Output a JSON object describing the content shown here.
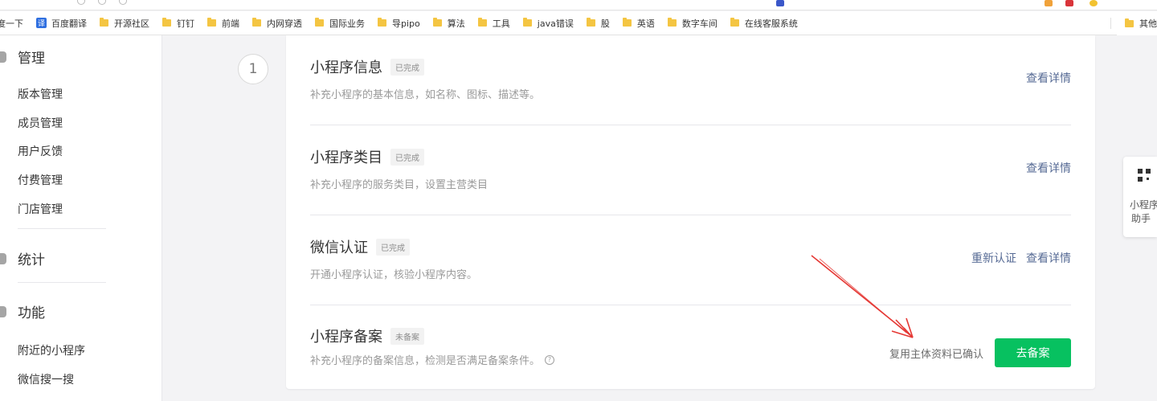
{
  "bookmarks": {
    "items": [
      {
        "label": "度一下",
        "icon": "none"
      },
      {
        "label": "百度翻译",
        "icon": "translate-icon",
        "glyph": "译"
      },
      {
        "label": "开源社区",
        "icon": "folder-icon"
      },
      {
        "label": "钉钉",
        "icon": "folder-icon"
      },
      {
        "label": "前端",
        "icon": "folder-icon"
      },
      {
        "label": "内网穿透",
        "icon": "folder-icon"
      },
      {
        "label": "国际业务",
        "icon": "folder-icon"
      },
      {
        "label": "导pipo",
        "icon": "folder-icon"
      },
      {
        "label": "算法",
        "icon": "folder-icon"
      },
      {
        "label": "工具",
        "icon": "folder-icon"
      },
      {
        "label": "java错误",
        "icon": "folder-icon"
      },
      {
        "label": "股",
        "icon": "folder-icon"
      },
      {
        "label": "英语",
        "icon": "folder-icon"
      },
      {
        "label": "数字车间",
        "icon": "folder-icon"
      },
      {
        "label": "在线客服系统",
        "icon": "folder-icon"
      }
    ],
    "other": "其他"
  },
  "sidebar": {
    "sections": [
      {
        "title": "管理",
        "items": [
          "版本管理",
          "成员管理",
          "用户反馈",
          "付费管理",
          "门店管理"
        ]
      },
      {
        "title": "统计",
        "items": []
      },
      {
        "title": "功能",
        "items": [
          "附近的小程序",
          "微信搜一搜"
        ]
      }
    ]
  },
  "main": {
    "step_number": "1",
    "rows": [
      {
        "title": "小程序信息",
        "badge": "已完成",
        "desc": "补充小程序的基本信息，如名称、图标、描述等。",
        "actions": [
          "查看详情"
        ]
      },
      {
        "title": "小程序类目",
        "badge": "已完成",
        "desc": "补充小程序的服务类目，设置主营类目",
        "actions": [
          "查看详情"
        ]
      },
      {
        "title": "微信认证",
        "badge": "已完成",
        "desc": "开通小程序认证，核验小程序内容。",
        "actions": [
          "重新认证",
          "查看详情"
        ]
      },
      {
        "title": "小程序备案",
        "badge": "未备案",
        "desc": "补充小程序的备案信息，检测是否满足备案条件。",
        "help_glyph": "?",
        "confirm_text": "复用主体资料已确认",
        "button": "去备案"
      }
    ]
  },
  "helper": {
    "line1": "小程序",
    "line2": "助手"
  },
  "colors": {
    "primary": "#07c160",
    "link": "#576b95",
    "annotation": "#e53935"
  }
}
